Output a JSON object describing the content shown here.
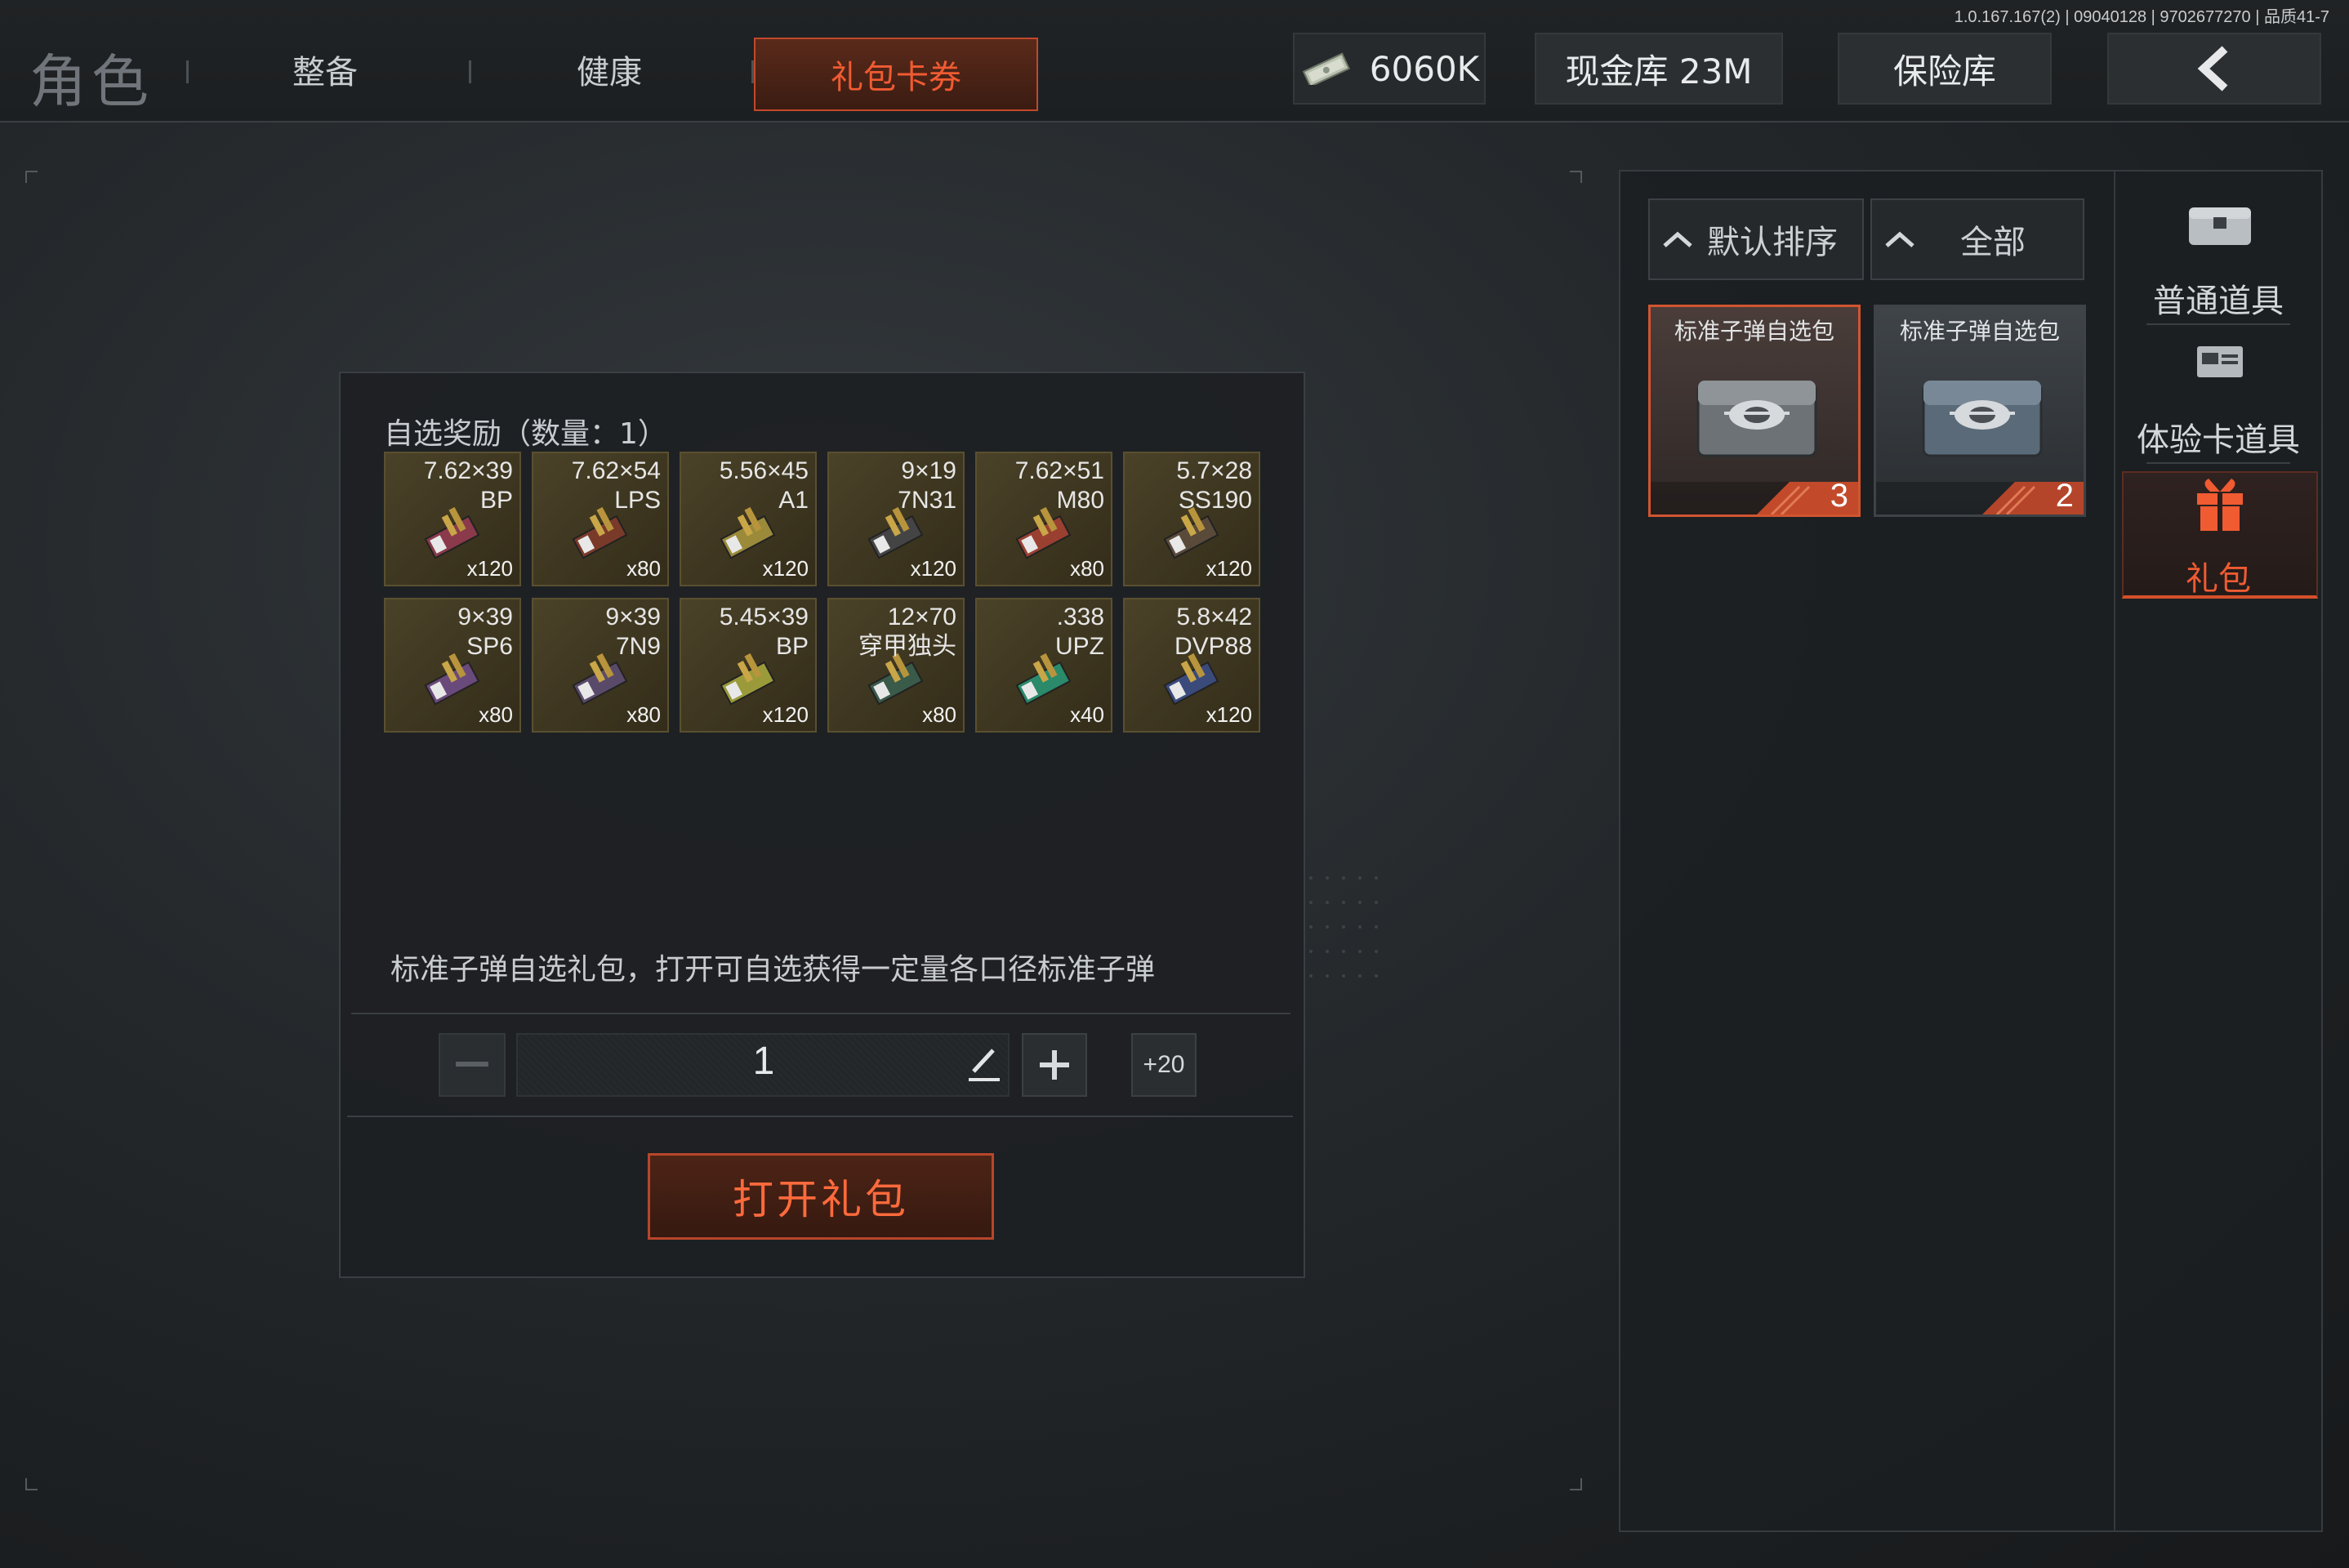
{
  "version": "1.0.167.167(2) | 09040128 | 9702677270 | 品质41-7",
  "page_title": "角色",
  "tabs": [
    {
      "label": "整备"
    },
    {
      "label": "健康"
    },
    {
      "label": "礼包卡券",
      "active": true
    }
  ],
  "header": {
    "money": "6060K",
    "cash_vault": "现金库 23M",
    "safe": "保险库"
  },
  "reward": {
    "title": "自选奖励（数量：1）",
    "items": [
      {
        "caliber": "7.62×39",
        "type": "BP",
        "qty": "x120",
        "color": "#8a3a4a"
      },
      {
        "caliber": "7.62×54",
        "type": "LPS",
        "qty": "x80",
        "color": "#7a3a2a"
      },
      {
        "caliber": "5.56×45",
        "type": "A1",
        "qty": "x120",
        "color": "#9a8a3a"
      },
      {
        "caliber": "9×19",
        "type": "7N31",
        "qty": "x120",
        "color": "#444444"
      },
      {
        "caliber": "7.62×51",
        "type": "M80",
        "qty": "x80",
        "color": "#9a4030"
      },
      {
        "caliber": "5.7×28",
        "type": "SS190",
        "qty": "x120",
        "color": "#5a4a3a"
      },
      {
        "caliber": "9×39",
        "type": "SP6",
        "qty": "x80",
        "color": "#6a4a7a"
      },
      {
        "caliber": "9×39",
        "type": "7N9",
        "qty": "x80",
        "color": "#5a4a6a"
      },
      {
        "caliber": "5.45×39",
        "type": "BP",
        "qty": "x120",
        "color": "#9a9a3a"
      },
      {
        "caliber": "12×70",
        "type": "穿甲独头",
        "qty": "x80",
        "color": "#3a5a4a"
      },
      {
        "caliber": ".338",
        "type": "UPZ",
        "qty": "x40",
        "color": "#2a8a6a"
      },
      {
        "caliber": "5.8×42",
        "type": "DVP88",
        "qty": "x120",
        "color": "#3a4a7a"
      }
    ],
    "description": "标准子弹自选礼包，打开可自选获得一定量各口径标准子弹",
    "quantity": "1",
    "plus20": "+20",
    "open_label": "打开礼包"
  },
  "inventory": {
    "sort_label": "默认排序",
    "filter_label": "全部",
    "cards": [
      {
        "name": "标准子弹自选包",
        "count": "3",
        "selected": true
      },
      {
        "name": "标准子弹自选包",
        "count": "2",
        "selected": false
      }
    ]
  },
  "categories": [
    {
      "label": "普通道具",
      "icon": "chest-icon"
    },
    {
      "label": "体验卡道具",
      "icon": "card-icon"
    },
    {
      "label": "礼包",
      "icon": "gift-icon",
      "active": true
    }
  ],
  "colors": {
    "accent": "#f05b32",
    "accent_border": "#c2482a"
  }
}
